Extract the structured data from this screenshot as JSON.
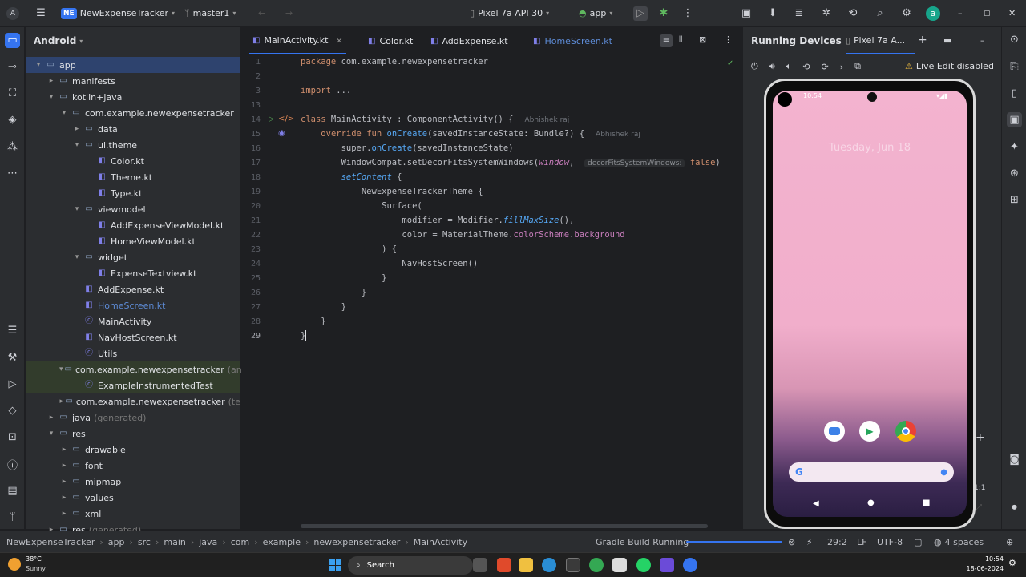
{
  "titlebar": {
    "project_badge": "NE",
    "project_name": "NewExpenseTracker",
    "branch": "master1",
    "device": "Pixel 7a API 30",
    "run_config": "app",
    "user_initial": "a"
  },
  "project_panel": {
    "view": "Android",
    "tree": [
      {
        "label": "app",
        "depth": 0,
        "arrow": "▾",
        "icon": "folder",
        "selected": true
      },
      {
        "label": "manifests",
        "depth": 1,
        "arrow": "▸",
        "icon": "folder"
      },
      {
        "label": "kotlin+java",
        "depth": 1,
        "arrow": "▾",
        "icon": "folder"
      },
      {
        "label": "com.example.newexpensetracker",
        "depth": 2,
        "arrow": "▾",
        "icon": "folder"
      },
      {
        "label": "data",
        "depth": 3,
        "arrow": "▸",
        "icon": "folder"
      },
      {
        "label": "ui.theme",
        "depth": 3,
        "arrow": "▾",
        "icon": "folder"
      },
      {
        "label": "Color.kt",
        "depth": 4,
        "arrow": "",
        "icon": "kt"
      },
      {
        "label": "Theme.kt",
        "depth": 4,
        "arrow": "",
        "icon": "kt"
      },
      {
        "label": "Type.kt",
        "depth": 4,
        "arrow": "",
        "icon": "kt"
      },
      {
        "label": "viewmodel",
        "depth": 3,
        "arrow": "▾",
        "icon": "folder"
      },
      {
        "label": "AddExpenseViewModel.kt",
        "depth": 4,
        "arrow": "",
        "icon": "kt"
      },
      {
        "label": "HomeViewModel.kt",
        "depth": 4,
        "arrow": "",
        "icon": "kt"
      },
      {
        "label": "widget",
        "depth": 3,
        "arrow": "▾",
        "icon": "folder"
      },
      {
        "label": "ExpenseTextview.kt",
        "depth": 4,
        "arrow": "",
        "icon": "kt"
      },
      {
        "label": "AddExpense.kt",
        "depth": 3,
        "arrow": "",
        "icon": "kt"
      },
      {
        "label": "HomeScreen.kt",
        "depth": 3,
        "arrow": "",
        "icon": "kt",
        "blue": true
      },
      {
        "label": "MainActivity",
        "depth": 3,
        "arrow": "",
        "icon": "class"
      },
      {
        "label": "NavHostScreen.kt",
        "depth": 3,
        "arrow": "",
        "icon": "kt"
      },
      {
        "label": "Utils",
        "depth": 3,
        "arrow": "",
        "icon": "class"
      },
      {
        "label": "com.example.newexpensetracker",
        "suffix": "(an",
        "depth": 2,
        "arrow": "▾",
        "icon": "folder",
        "test": true
      },
      {
        "label": "ExampleInstrumentedTest",
        "depth": 3,
        "arrow": "",
        "icon": "class",
        "test": true
      },
      {
        "label": "com.example.newexpensetracker",
        "suffix": "(te",
        "depth": 2,
        "arrow": "▸",
        "icon": "folder"
      },
      {
        "label": "java",
        "suffix": "(generated)",
        "depth": 1,
        "arrow": "▸",
        "icon": "folder"
      },
      {
        "label": "res",
        "depth": 1,
        "arrow": "▾",
        "icon": "folder"
      },
      {
        "label": "drawable",
        "depth": 2,
        "arrow": "▸",
        "icon": "folder"
      },
      {
        "label": "font",
        "depth": 2,
        "arrow": "▸",
        "icon": "folder"
      },
      {
        "label": "mipmap",
        "depth": 2,
        "arrow": "▸",
        "icon": "folder"
      },
      {
        "label": "values",
        "depth": 2,
        "arrow": "▸",
        "icon": "folder"
      },
      {
        "label": "xml",
        "depth": 2,
        "arrow": "▸",
        "icon": "folder"
      },
      {
        "label": "res",
        "suffix": "(generated)",
        "depth": 1,
        "arrow": "▸",
        "icon": "folder"
      }
    ]
  },
  "editor": {
    "tabs": [
      {
        "label": "MainActivity.kt",
        "active": true,
        "close": "×"
      },
      {
        "label": "Color.kt"
      },
      {
        "label": "AddExpense.kt"
      },
      {
        "label": "HomeScreen.kt",
        "blue": true
      }
    ],
    "line_numbers": [
      "1",
      "2",
      "3",
      "13",
      "14",
      "15",
      "16",
      "17",
      "18",
      "19",
      "20",
      "21",
      "22",
      "23",
      "24",
      "25",
      "26",
      "27",
      "28",
      "29"
    ],
    "author": "Abhishek raj",
    "lines": [
      "package com.example.newexpensetracker",
      "",
      "import ...",
      "",
      "class MainActivity : ComponentActivity() {",
      "    override fun onCreate(savedInstanceState: Bundle?) {",
      "        super.onCreate(savedInstanceState)",
      "        WindowCompat.setDecorFitsSystemWindows(window,  decorFitsSystemWindows: false)",
      "        setContent {",
      "            NewExpenseTrackerTheme {",
      "                Surface(",
      "                    modifier = Modifier.fillMaxSize(),",
      "                    color = MaterialTheme.colorScheme.background",
      "                ) {",
      "                    NavHostScreen()",
      "                }",
      "            }",
      "        }",
      "    }",
      "}"
    ]
  },
  "devices": {
    "title": "Running Devices",
    "device_tab": "Pixel 7a A...",
    "live_edit": "Live Edit disabled",
    "phone_time": "10:54",
    "phone_date": "Tuesday, Jun 18"
  },
  "breadcrumb": [
    "NewExpenseTracker",
    "app",
    "src",
    "main",
    "java",
    "com",
    "example",
    "newexpensetracker",
    "MainActivity"
  ],
  "status": {
    "task": "Gradle Build Running",
    "position": "29:2",
    "line_sep": "LF",
    "encoding": "UTF-8",
    "indent": "4 spaces"
  },
  "taskbar": {
    "temp": "38°C",
    "weather": "Sunny",
    "search": "Search",
    "time": "10:54",
    "date": "18-06-2024"
  }
}
